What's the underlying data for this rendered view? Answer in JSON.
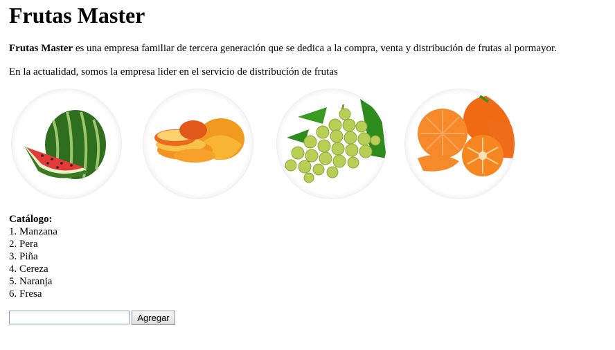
{
  "header": {
    "title": "Frutas Master"
  },
  "intro": {
    "brand": "Frutas Master",
    "text": " es una empresa familiar de tercera generación que se dedica a la compra, venta y distribución de frutas al pormayor.",
    "second_line": "En la actualidad, somos la empresa lider en el servicio de distribución de frutas"
  },
  "gallery": {
    "images": [
      {
        "name": "watermelon",
        "icon": "watermelon-image"
      },
      {
        "name": "peach",
        "icon": "peach-image"
      },
      {
        "name": "grapes",
        "icon": "grapes-image"
      },
      {
        "name": "tangerine",
        "icon": "tangerine-image"
      }
    ]
  },
  "catalog": {
    "title": "Catálogo:",
    "items": [
      "1. Manzana",
      "2. Pera",
      "3. Piña",
      "4. Cereza",
      "5. Naranja",
      "6. Fresa"
    ]
  },
  "form": {
    "input_value": "",
    "button_label": "Agregar"
  }
}
